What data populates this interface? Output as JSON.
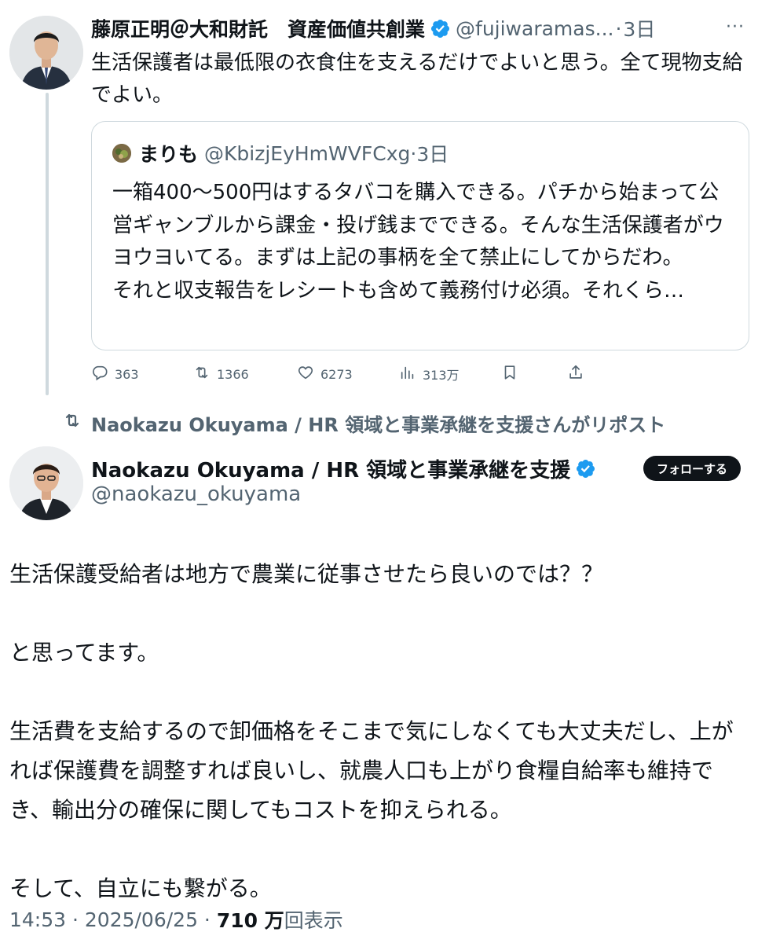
{
  "tweet1": {
    "author_name": "藤原正明＠大和財託　資産価値共創業",
    "handle": "@fujiwaramas...",
    "time": "3日",
    "text": "生活保護者は最低限の衣食住を支えるだけでよいと思う。全て現物支給でよい。",
    "quote": {
      "author_name": "まりも",
      "handle": "@KbizjEyHmWVFCxg",
      "time": "3日",
      "text": "一箱400〜500円はするタバコを購入できる。パチから始まって公営ギャンブルから課金・投げ銭までできる。そんな生活保護者がウヨウヨいてる。まずは上記の事柄を全て禁止にしてからだわ。",
      "text2": "それと収支報告をレシートも含めて義務付け必須。それくら…"
    },
    "actions": {
      "replies": "363",
      "reposts": "1366",
      "likes": "6273",
      "views": "313万"
    }
  },
  "repost_bar": {
    "label": "Naokazu Okuyama / HR 領域と事業承継を支援さんがリポスト"
  },
  "tweet2": {
    "author_name": "Naokazu Okuyama / HR 領域と事業承継を支援",
    "handle": "@naokazu_okuyama",
    "follow_label": "フォローする",
    "paragraphs": [
      "生活保護受給者は地方で農業に従事させたら良いのでは？？",
      "と思ってます。",
      "生活費を支給するので卸価格をそこまで気にしなくても大丈夫だし、上がれば保護費を調整すれば良いし、就農人口も上がり食糧自給率も維持でき、輸出分の確保に関してもコストを抑えられる。",
      "そして、自立にも繋がる。"
    ],
    "time": "14:53",
    "date": "2025/06/25",
    "views_count": "710 万",
    "views_label": "回表示"
  },
  "colors": {
    "verified": "#1d9bf0",
    "muted": "#536471",
    "text": "#0f1419",
    "border": "#cfd9de",
    "follow_bg": "#0f1419"
  },
  "icons": [
    "verified-badge-icon",
    "more-icon",
    "reply-icon",
    "repost-icon",
    "like-icon",
    "views-icon",
    "bookmark-icon",
    "share-icon"
  ]
}
